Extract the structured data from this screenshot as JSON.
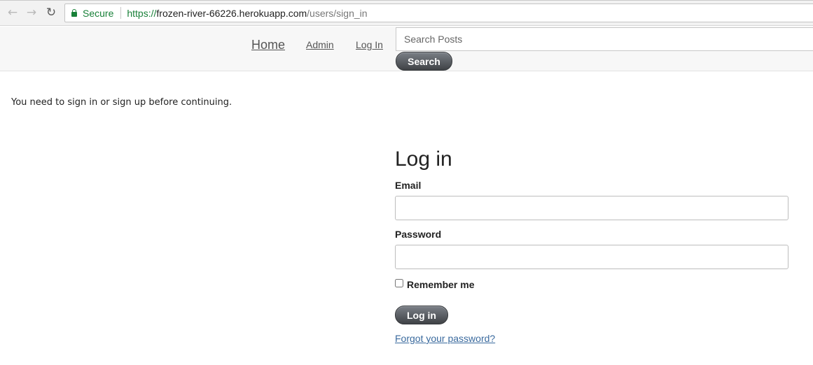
{
  "browser": {
    "secure_label": "Secure",
    "url_scheme": "https://",
    "url_domain": "frozen-river-66226.herokuapp.com",
    "url_path": "/users/sign_in"
  },
  "nav": {
    "home": "Home",
    "admin": "Admin",
    "login": "Log In"
  },
  "search": {
    "placeholder": "Search Posts",
    "button": "Search"
  },
  "flash": "You need to sign in or sign up before continuing.",
  "form": {
    "title": "Log in",
    "email_label": "Email",
    "email_value": "",
    "password_label": "Password",
    "password_value": "",
    "remember_label": "Remember me",
    "remember_checked": false,
    "submit": "Log in",
    "forgot": "Forgot your password?"
  },
  "colors": {
    "secure_green": "#188038",
    "button_dark": "#3f4246",
    "link_blue": "#3a6a9e"
  }
}
